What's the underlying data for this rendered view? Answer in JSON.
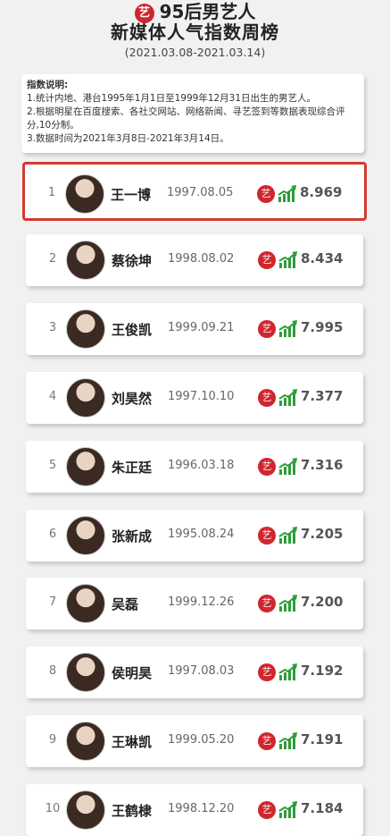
{
  "header": {
    "logo_char": "艺",
    "title_line1": "95后男艺人",
    "title_line2": "新媒体人气指数周榜",
    "date_range": "(2021.03.08-2021.03.14)"
  },
  "notes": {
    "heading": "指数说明:",
    "line1": "1.统计内地、港台1995年1月1日至1999年12月31日出生的男艺人。",
    "line2": "2.根据明星在百度搜索、各社交网站、网络新闻、寻艺签到等数据表现综合评分,10分制。",
    "line3": "3.数据时间为2021年3月8日-2021年3月14日。"
  },
  "badge_char": "艺",
  "colors": {
    "accent_red": "#d0262d",
    "trend_green": "#2e9c3a",
    "highlight_border": "#d33a31"
  },
  "rankings": [
    {
      "rank": "1",
      "name": "王一博",
      "birth": "1997.08.05",
      "score": "8.969",
      "highlighted": true
    },
    {
      "rank": "2",
      "name": "蔡徐坤",
      "birth": "1998.08.02",
      "score": "8.434",
      "highlighted": false
    },
    {
      "rank": "3",
      "name": "王俊凯",
      "birth": "1999.09.21",
      "score": "7.995",
      "highlighted": false
    },
    {
      "rank": "4",
      "name": "刘昊然",
      "birth": "1997.10.10",
      "score": "7.377",
      "highlighted": false
    },
    {
      "rank": "5",
      "name": "朱正廷",
      "birth": "1996.03.18",
      "score": "7.316",
      "highlighted": false
    },
    {
      "rank": "6",
      "name": "张新成",
      "birth": "1995.08.24",
      "score": "7.205",
      "highlighted": false
    },
    {
      "rank": "7",
      "name": "吴磊",
      "birth": "1999.12.26",
      "score": "7.200",
      "highlighted": false
    },
    {
      "rank": "8",
      "name": "侯明昊",
      "birth": "1997.08.03",
      "score": "7.192",
      "highlighted": false
    },
    {
      "rank": "9",
      "name": "王琳凯",
      "birth": "1999.05.20",
      "score": "7.191",
      "highlighted": false
    },
    {
      "rank": "10",
      "name": "王鹤棣",
      "birth": "1998.12.20",
      "score": "7.184",
      "highlighted": false
    }
  ]
}
